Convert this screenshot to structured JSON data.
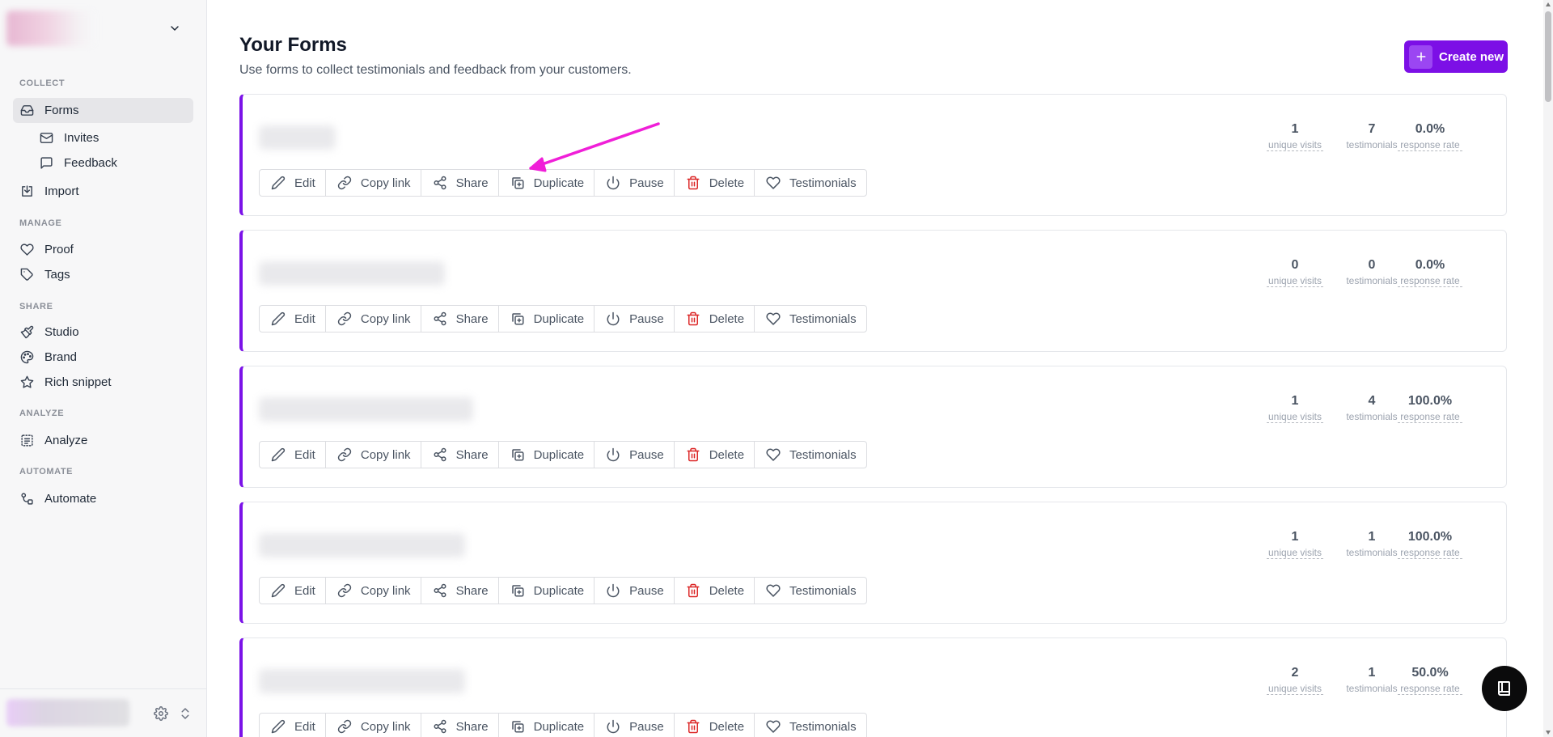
{
  "sidebar": {
    "sections": {
      "collect": "COLLECT",
      "manage": "MANAGE",
      "share": "SHARE",
      "analyze": "ANALYZE",
      "automate": "AUTOMATE"
    },
    "items": {
      "forms": "Forms",
      "invites": "Invites",
      "feedback": "Feedback",
      "import": "Import",
      "proof": "Proof",
      "tags": "Tags",
      "studio": "Studio",
      "brand": "Brand",
      "rich_snippet": "Rich snippet",
      "analyze": "Analyze",
      "automate": "Automate"
    },
    "active_item": "Forms"
  },
  "header": {
    "title": "Your Forms",
    "subtitle": "Use forms to collect testimonials and feedback from your customers.",
    "create_label": "Create new"
  },
  "actions": {
    "edit": "Edit",
    "copy_link": "Copy link",
    "share": "Share",
    "duplicate": "Duplicate",
    "pause": "Pause",
    "delete": "Delete",
    "testimonials": "Testimonials"
  },
  "stat_labels": {
    "visits": "unique visits",
    "testimonials": "testimonials",
    "rate": "response rate"
  },
  "forms": [
    {
      "visits": "1",
      "testimonials": "7",
      "rate": "0.0%"
    },
    {
      "visits": "0",
      "testimonials": "0",
      "rate": "0.0%"
    },
    {
      "visits": "1",
      "testimonials": "4",
      "rate": "100.0%"
    },
    {
      "visits": "1",
      "testimonials": "1",
      "rate": "100.0%"
    },
    {
      "visits": "2",
      "testimonials": "1",
      "rate": "50.0%"
    }
  ],
  "colors": {
    "accent": "#7c0fe6",
    "card_border_left": "#7b12e8",
    "delete_icon": "#dc2626",
    "annotation_arrow": "#f01fd8"
  },
  "icons": {
    "workspace_toggle": "chevron-down-icon",
    "forms": "inbox-icon",
    "invites": "mail-icon",
    "feedback": "message-square-icon",
    "import": "import-icon",
    "proof": "heart-icon",
    "tags": "tag-icon",
    "studio": "brush-icon",
    "brand": "palette-icon",
    "rich_snippet": "star-icon",
    "analyze": "analyze-icon",
    "automate": "workflow-icon",
    "settings": "gear-icon",
    "account_switch": "chevrons-up-down-icon",
    "chat": "book-icon"
  }
}
